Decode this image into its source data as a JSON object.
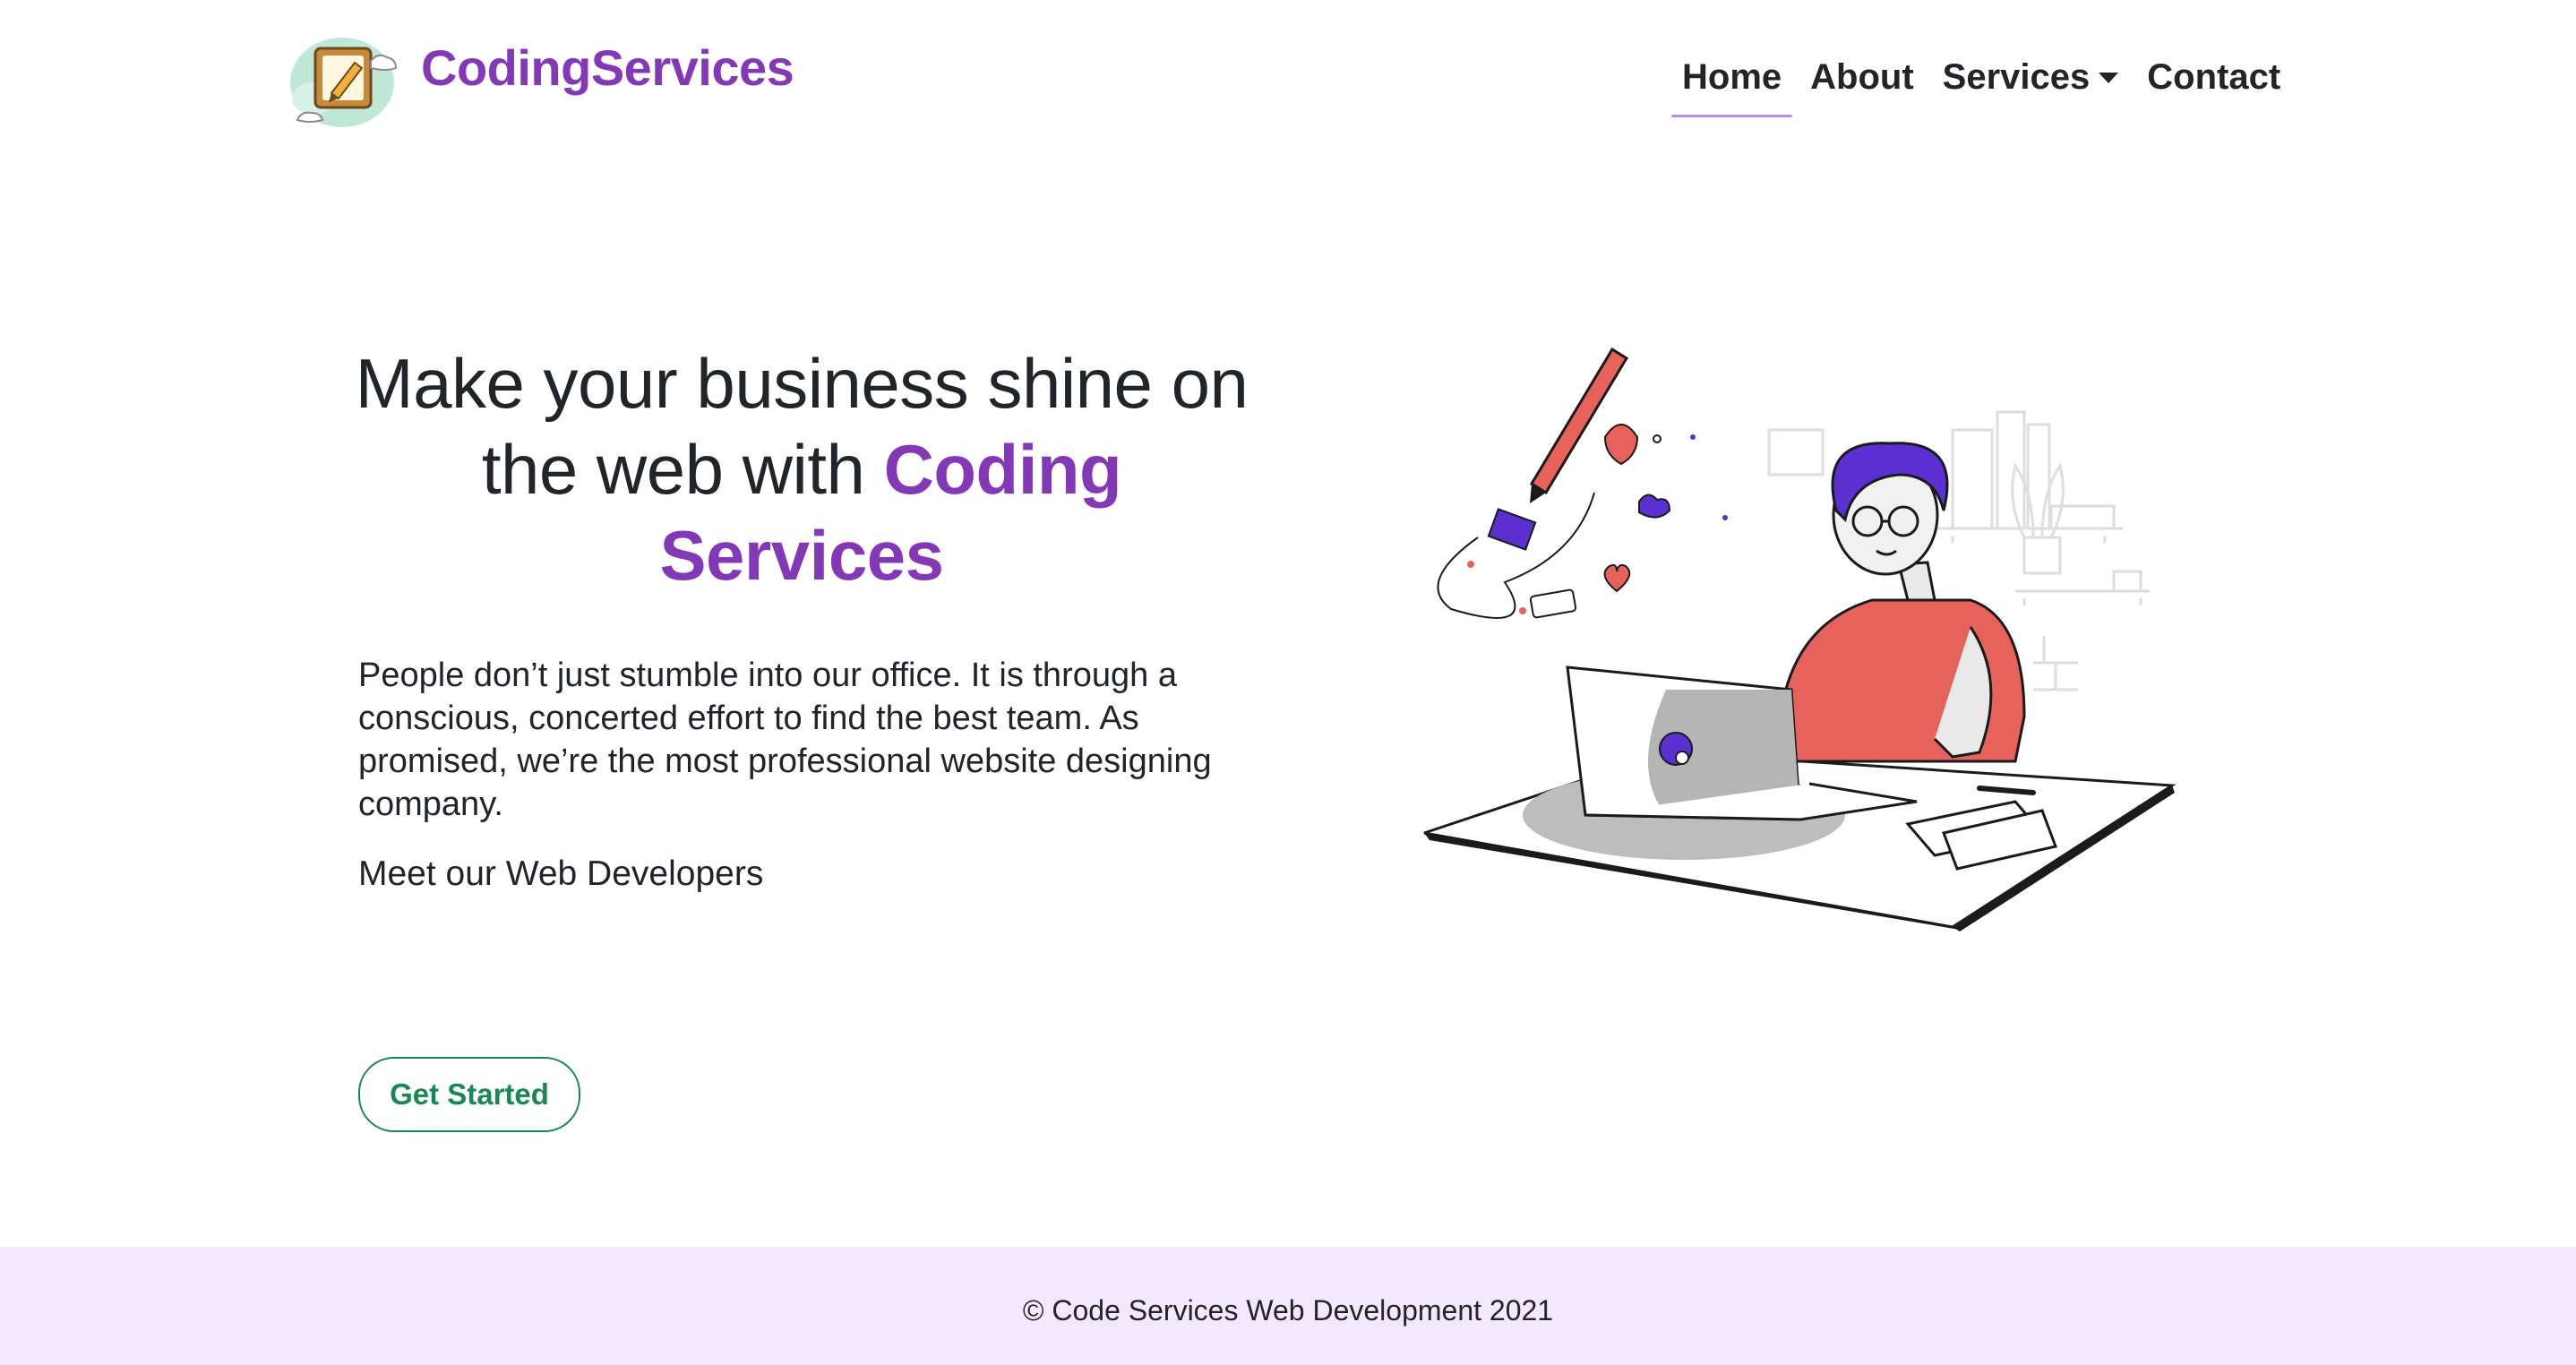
{
  "brand": {
    "name": "CodingServices",
    "logo_icon": "pencil-notepad-logo-icon"
  },
  "nav": {
    "items": [
      {
        "label": "Home",
        "active": true
      },
      {
        "label": "About",
        "active": false
      },
      {
        "label": "Services",
        "active": false,
        "dropdown": true
      },
      {
        "label": "Contact",
        "active": false
      }
    ]
  },
  "hero": {
    "title_prefix": "Make your business shine on the web with",
    "title_accent": "Coding Services",
    "paragraph": "People don’t just stumble into our office. It is through a conscious, concerted effort to find the best team. As promised, we’re the most professional website designing company.",
    "subheading": "Meet our Web Developers",
    "cta_label": "Get Started",
    "illustration": "developer-at-laptop-illustration"
  },
  "footer": {
    "text": "© Code Services Web Development 2021"
  },
  "colors": {
    "brand_purple": "#8338b8",
    "nav_underline": "#b98be6",
    "cta_green": "#198754",
    "footer_bg": "#f3e8fd",
    "illustration_shirt": "#e8625c",
    "illustration_hair": "#5b2fd0"
  }
}
